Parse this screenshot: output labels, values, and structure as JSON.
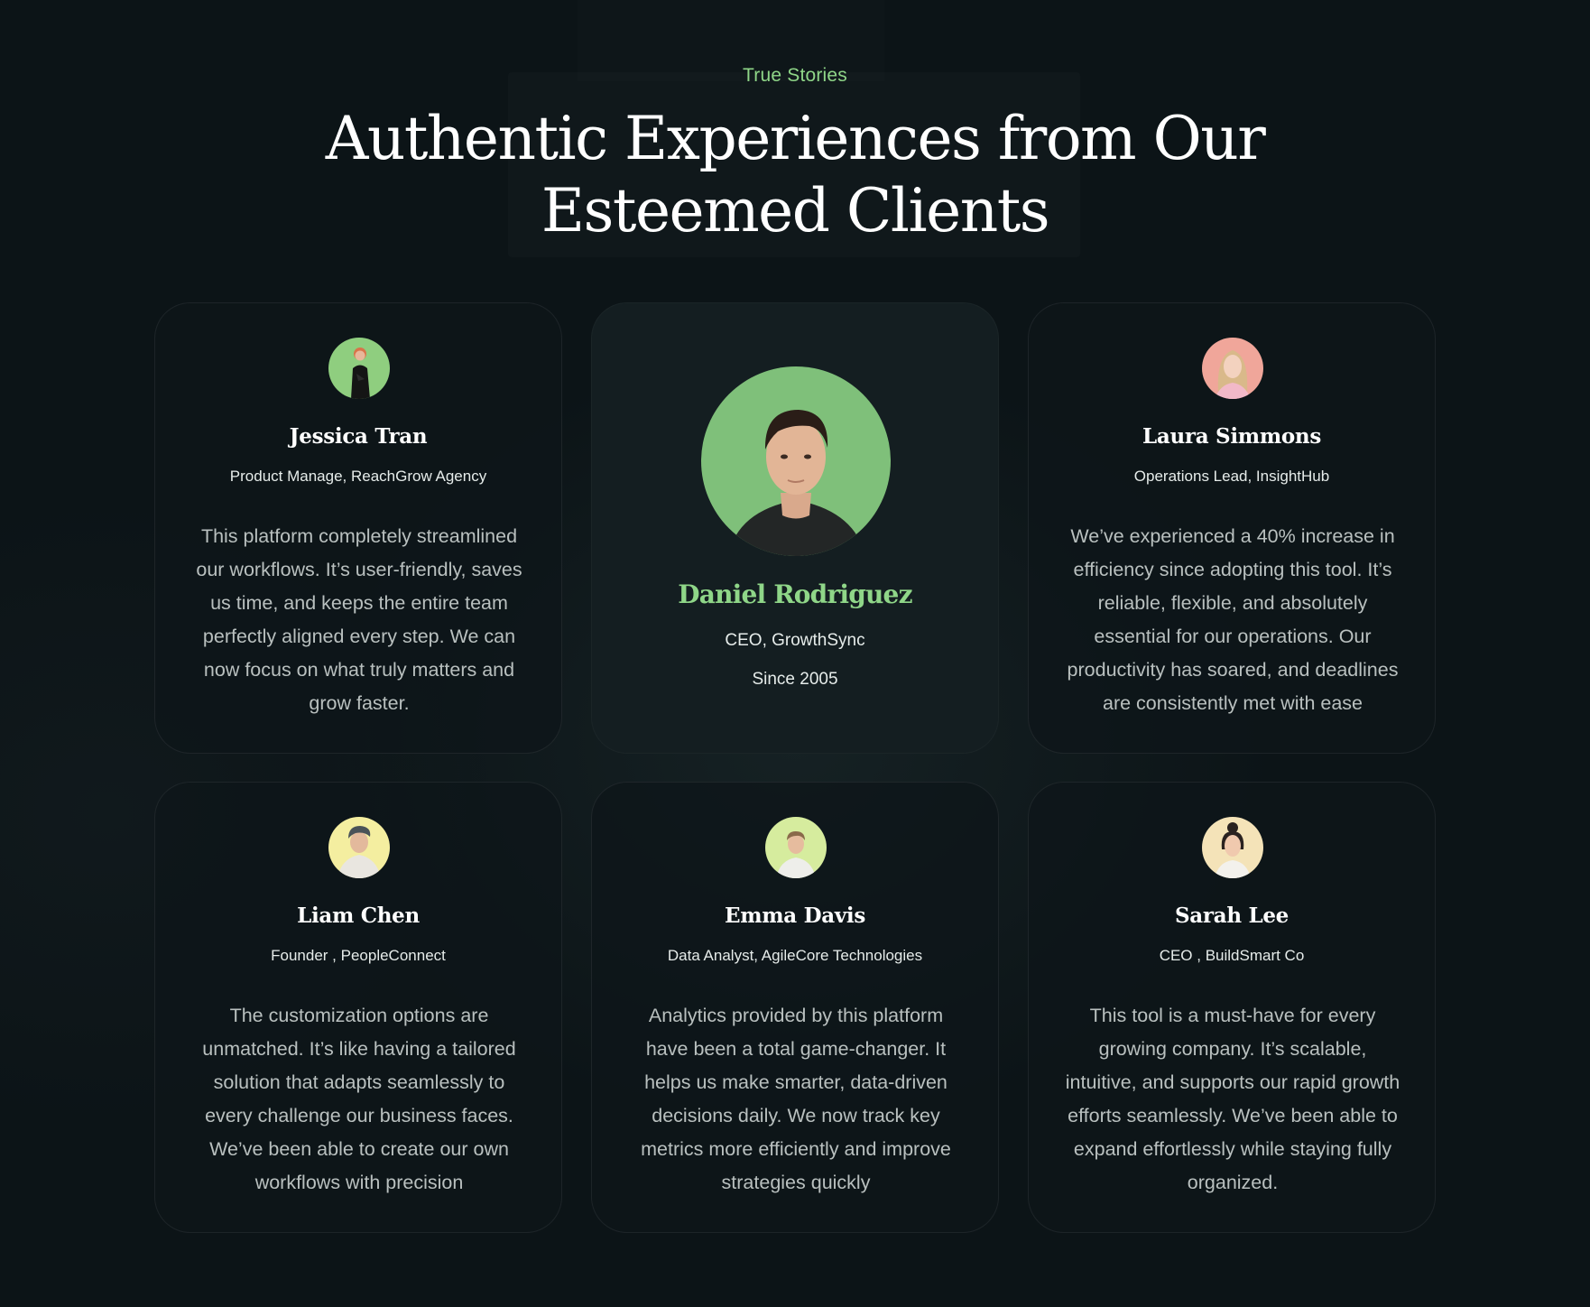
{
  "section": {
    "eyebrow": "True Stories",
    "title": "Authentic Experiences from Our Esteemed Clients",
    "accent_color": "#8fd688"
  },
  "testimonials": [
    {
      "name": "Jessica Tran",
      "role": "Product Manage, ReachGrow Agency",
      "quote": "This platform completely streamlined our workflows. It’s user-friendly, saves us time, and keeps the entire team perfectly aligned every step. We can now focus on what truly matters and grow faster.",
      "avatar_bg": "#8fce7f"
    },
    {
      "name": "Daniel Rodriguez",
      "role": "CEO, GrowthSync",
      "since": "Since 2005",
      "avatar_bg": "#7fc07a",
      "featured": true
    },
    {
      "name": "Laura Simmons",
      "role": "Operations Lead, InsightHub",
      "quote": "We’ve experienced a 40% increase in efficiency since adopting this tool. It’s reliable, flexible, and absolutely essential for our operations. Our productivity has soared, and deadlines are consistently met with ease",
      "avatar_bg": "#f0a69a"
    },
    {
      "name": "Liam Chen",
      "role": "Founder , PeopleConnect",
      "quote": "The customization options are unmatched. It’s like having a tailored solution that adapts seamlessly to every challenge our business faces. We’ve been able to create our own workflows with precision",
      "avatar_bg": "#f4eea0"
    },
    {
      "name": "Emma Davis",
      "role": "Data Analyst, AgileCore Technologies",
      "quote": "Analytics provided by this platform have been a total game-changer. It helps us make smarter, data-driven decisions daily. We now track key metrics more efficiently and improve strategies quickly",
      "avatar_bg": "#d6ec9e"
    },
    {
      "name": "Sarah Lee",
      "role": "CEO ,  BuildSmart Co",
      "quote": "This tool is a must-have for every growing company. It’s scalable, intuitive, and supports our rapid growth efforts seamlessly. We’ve been able to expand effortlessly while staying fully organized.",
      "avatar_bg": "#f4e3b8"
    }
  ]
}
